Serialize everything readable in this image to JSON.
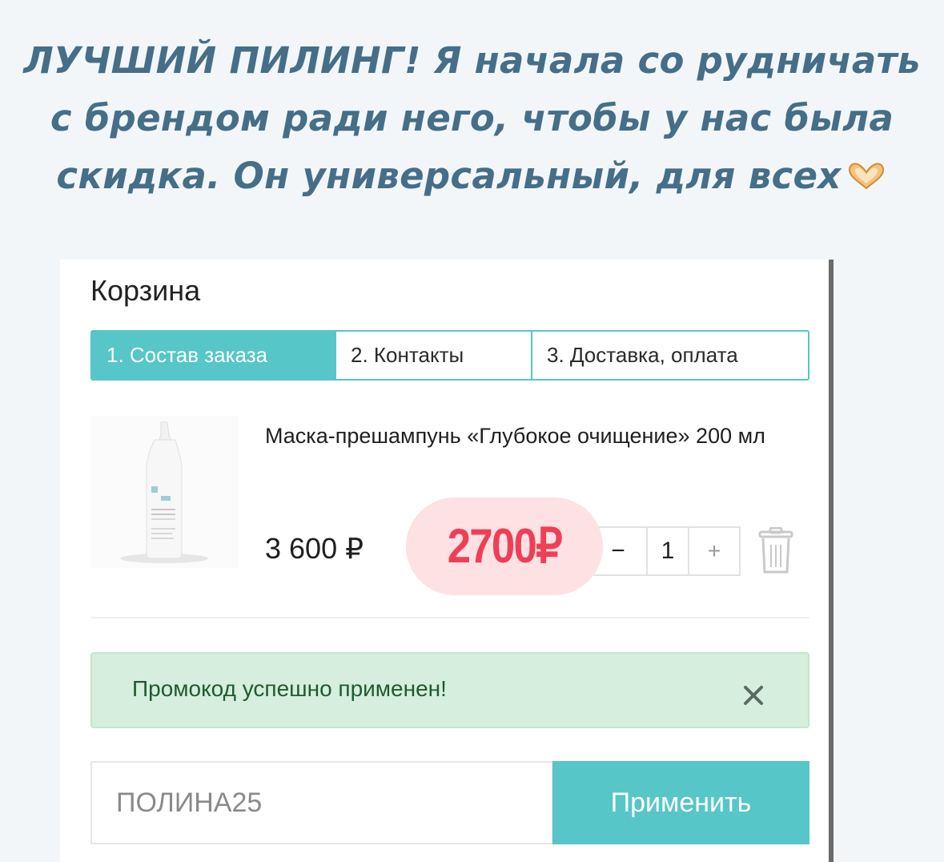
{
  "caption": {
    "line1": "ЛУЧШИЙ ПИЛИНГ! Я начала со рудничать",
    "line2": "с брендом ради него, чтобы у нас была",
    "line3": "скидка. Он универсальный, для всех",
    "emoji": "heart-hands-emoji"
  },
  "cart": {
    "title": "Корзина",
    "steps": [
      {
        "label": "1. Состав заказа",
        "active": true
      },
      {
        "label": "2. Контакты",
        "active": false
      },
      {
        "label": "3. Доставка, оплата",
        "active": false
      }
    ],
    "item": {
      "name": "Маска-прешампунь «Глубокое очищение» 200 мл",
      "old_price": "3 600 ₽",
      "new_price": "2700₽",
      "quantity": "1",
      "minus": "−",
      "plus": "+"
    },
    "alert": {
      "text": "Промокод успешно применен!",
      "close": "×"
    },
    "promo": {
      "value": "ПОЛИНА25",
      "apply_label": "Применить"
    }
  },
  "colors": {
    "accent": "#56c6c8",
    "caption": "#456e88",
    "new_price": "#ef3f57",
    "alert_bg": "#d6eedd"
  }
}
